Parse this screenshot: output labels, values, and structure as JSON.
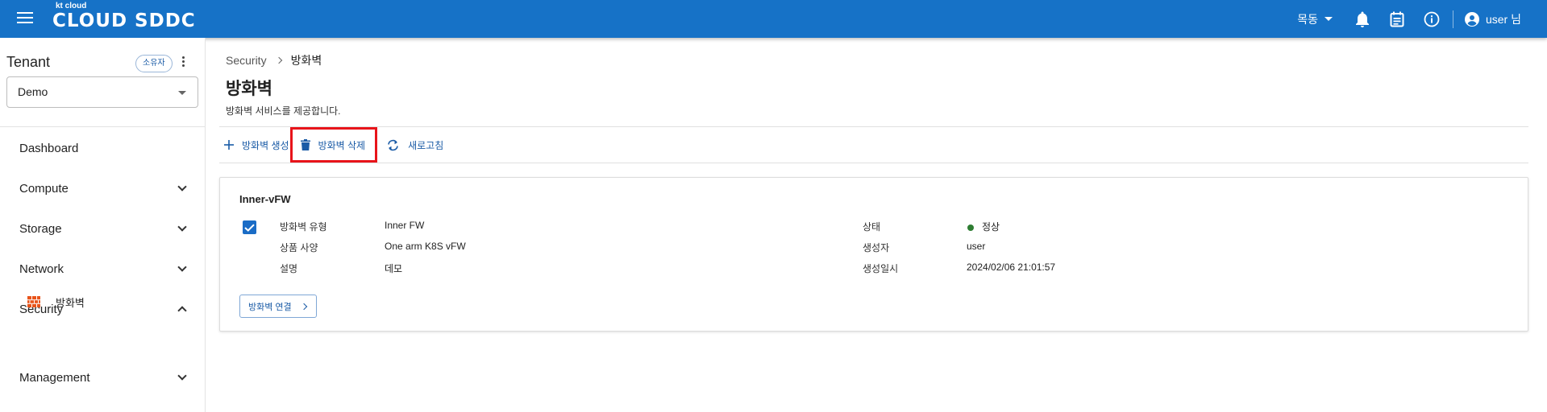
{
  "header": {
    "logo_small": "kt cloud",
    "logo_main": "CLOUD SDDC",
    "region": "목동",
    "user_label": "user 님",
    "icons": [
      "menu-icon",
      "bell-icon",
      "calendar-icon",
      "info-icon",
      "account-circle-icon"
    ]
  },
  "sidebar": {
    "tenant_title": "Tenant",
    "owner_badge": "소유자",
    "tenant_selected": "Demo",
    "items": [
      {
        "label": "Dashboard"
      },
      {
        "label": "Compute"
      },
      {
        "label": "Storage"
      },
      {
        "label": "Network"
      },
      {
        "label": "Security"
      },
      {
        "label": "Management"
      }
    ],
    "sub_item": {
      "label": "방화벽",
      "icon": "firewall-icon"
    }
  },
  "main": {
    "breadcrumb": [
      "Security",
      "방화벽"
    ],
    "title": "방화벽",
    "description": "방화벽 서비스를 제공합니다.",
    "toolbar": {
      "create_label": "방화벽 생성",
      "delete_label": "방화벽 삭제",
      "refresh_label": "새로고침"
    },
    "card": {
      "title": "Inner-vFW",
      "checked": true,
      "fields_left": [
        {
          "label": "방화벽 유형",
          "value": "Inner FW"
        },
        {
          "label": "상품 사양",
          "value": "One arm K8S vFW"
        },
        {
          "label": "설명",
          "value": "데모"
        }
      ],
      "fields_right": [
        {
          "label": "상태",
          "value": "정상"
        },
        {
          "label": "생성자",
          "value": "user"
        },
        {
          "label": "생성일시",
          "value": "2024/02/06 21:01:57"
        }
      ],
      "status_color": "#2e7d32",
      "connect_label": "방화벽 연결"
    }
  },
  "colors": {
    "topbar": "#1672c7",
    "accent": "#1a5ba6",
    "highlight": "#e8141a"
  }
}
